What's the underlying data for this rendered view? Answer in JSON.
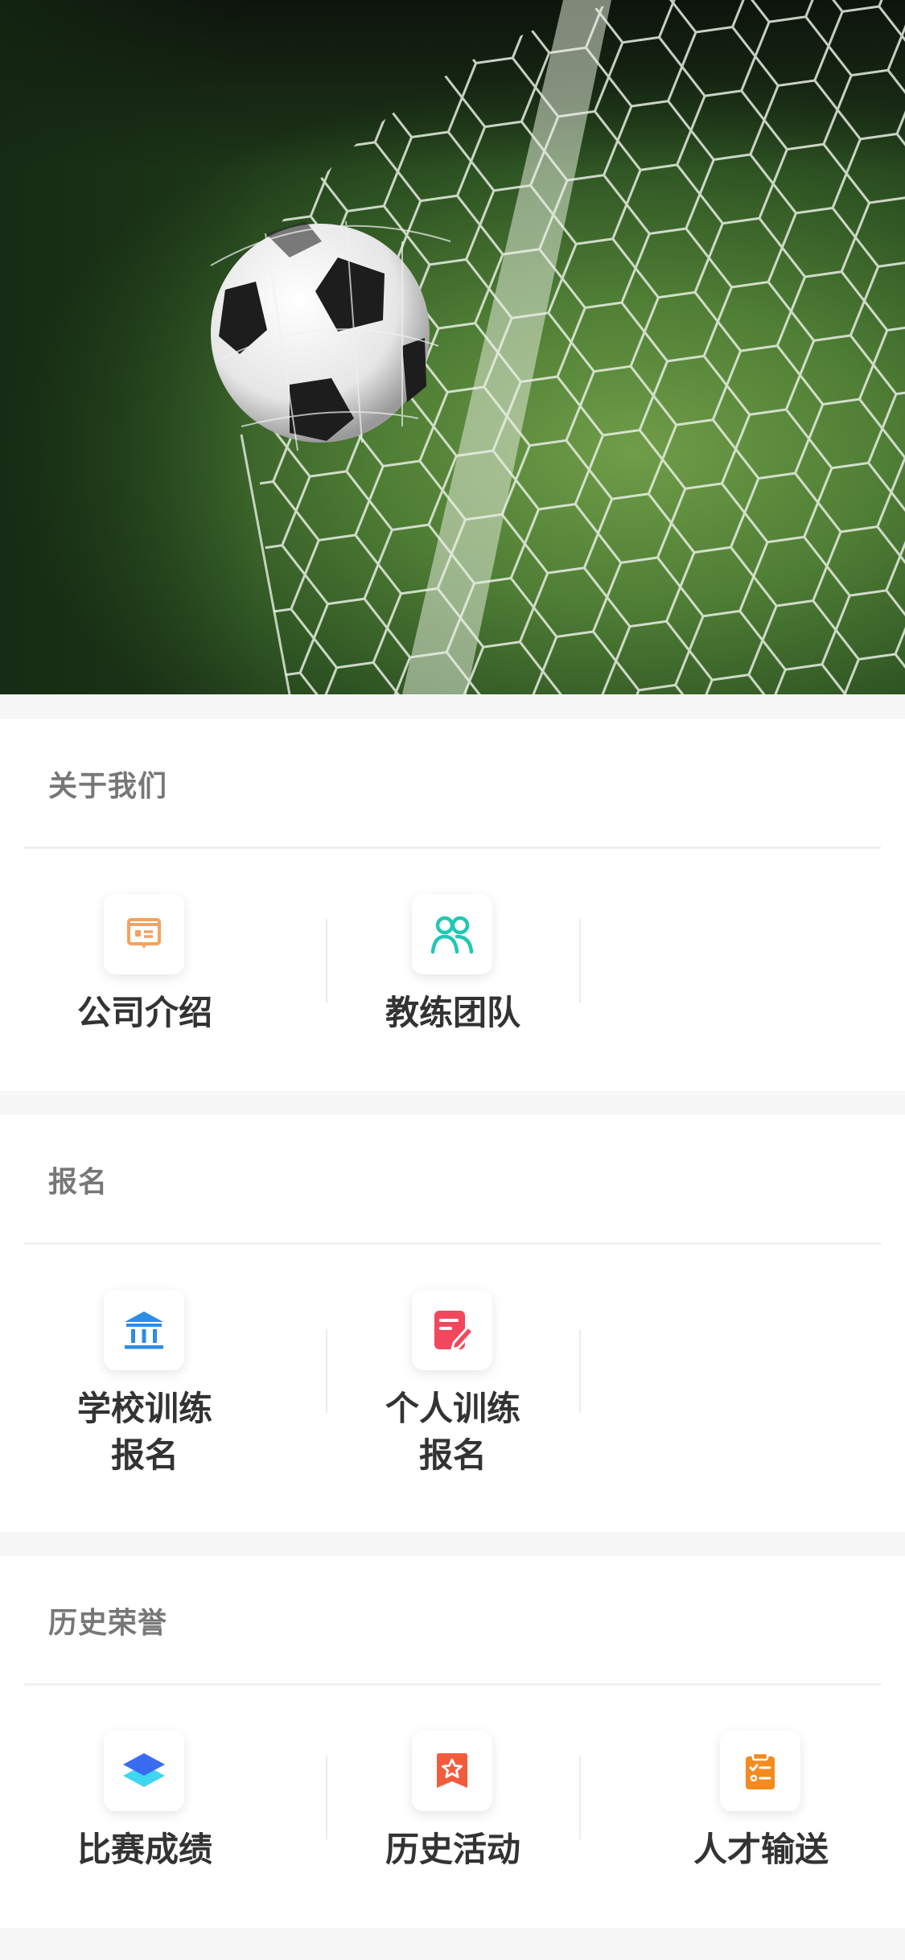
{
  "hero": {
    "image": "soccer-ball-in-goal-net"
  },
  "sections": [
    {
      "title": "关于我们",
      "items": [
        {
          "label": "公司介绍",
          "icon": "presentation-board-icon",
          "color": "#F5A25D"
        },
        {
          "label": "教练团队",
          "icon": "people-group-icon",
          "color": "#1FC8B4"
        }
      ]
    },
    {
      "title": "报名",
      "items": [
        {
          "label": "学校训练\n报名",
          "icon": "school-building-icon",
          "color": "#2E8BE6"
        },
        {
          "label": "个人训练\n报名",
          "icon": "edit-form-icon",
          "color": "#F2475C"
        }
      ]
    },
    {
      "title": "历史荣誉",
      "items": [
        {
          "label": "比赛成绩",
          "icon": "layers-stack-icon",
          "color": "#3B6CF0"
        },
        {
          "label": "历史活动",
          "icon": "star-bookmark-icon",
          "color": "#F25C3C"
        },
        {
          "label": "人才输送",
          "icon": "clipboard-checklist-icon",
          "color": "#F58A1F"
        }
      ]
    }
  ]
}
